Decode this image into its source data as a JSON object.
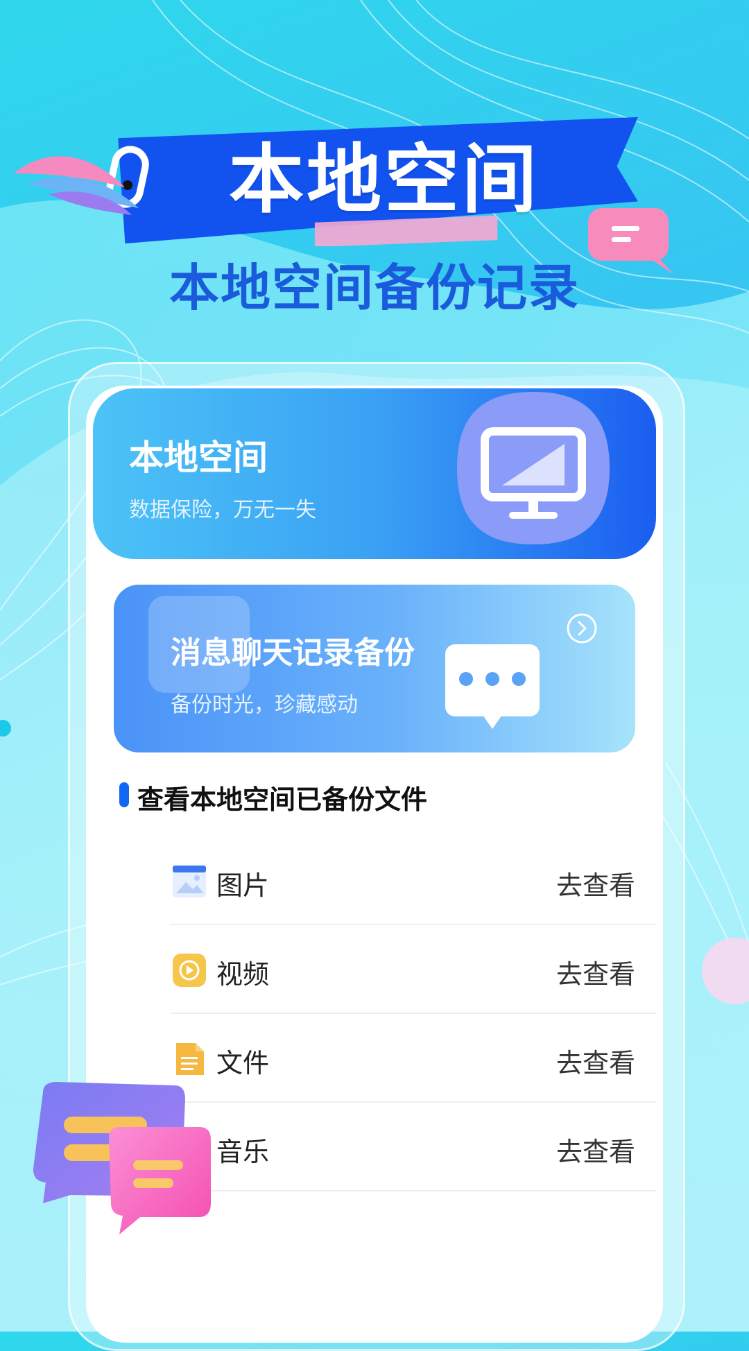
{
  "banner": {
    "title": "本地空间"
  },
  "subtitle": "本地空间备份记录",
  "top_card": {
    "title": "本地空间",
    "subtitle": "数据保险，万无一失"
  },
  "chat_card": {
    "title": "消息聊天记录备份",
    "subtitle": "备份时光，珍藏感动"
  },
  "section": {
    "title": "查看本地空间已备份文件"
  },
  "files": [
    {
      "label": "图片",
      "action": "去查看",
      "icon": "image-icon"
    },
    {
      "label": "视频",
      "action": "去查看",
      "icon": "video-icon"
    },
    {
      "label": "文件",
      "action": "去查看",
      "icon": "document-icon"
    },
    {
      "label": "音乐",
      "action": "去查看",
      "icon": "music-icon"
    }
  ],
  "colors": {
    "brand_blue": "#1166f2",
    "banner_blue": "#1253f0",
    "subtitle_blue": "#1a5bdc"
  }
}
